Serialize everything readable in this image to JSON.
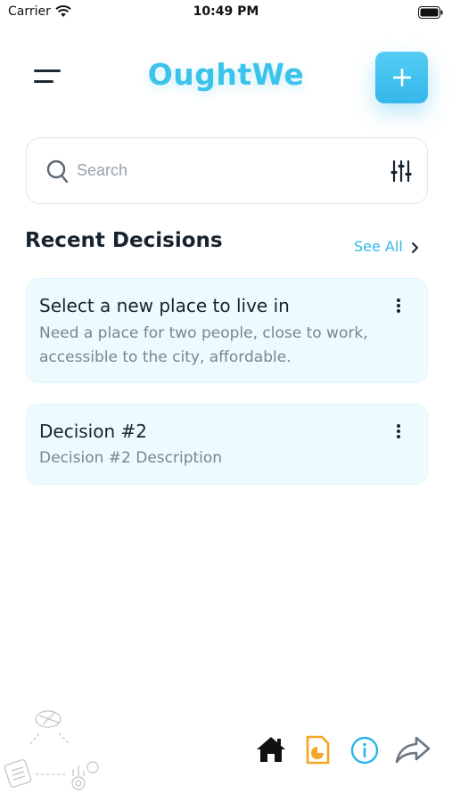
{
  "status_bar": {
    "carrier": "Carrier",
    "time": "10:49 PM",
    "icons": [
      "wifi-icon",
      "battery-icon"
    ]
  },
  "header": {
    "title": "OughtWe",
    "menu_icon": "menu-icon",
    "add_icon": "plus-icon"
  },
  "search": {
    "placeholder": "Search",
    "value": "",
    "search_icon": "search-icon",
    "filter_icon": "sliders-icon"
  },
  "recent": {
    "heading": "Recent Decisions",
    "see_all_label": "See All",
    "decisions": [
      {
        "title": "Select a new place to live in",
        "description": "Need a place for two people, close to work, accessible to the city, affordable."
      },
      {
        "title": "Decision #2",
        "description": "Decision #2 Description"
      }
    ]
  },
  "bottom_nav": {
    "items": [
      "home-icon",
      "report-icon",
      "info-icon",
      "share-icon"
    ]
  },
  "colors": {
    "accent": "#3cc3ec",
    "button": "#34b7ea",
    "card_bg": "#eefbfe",
    "text_dark": "#17242f",
    "text_muted": "#7b858c",
    "report_orange": "#f5a623",
    "info_blue": "#2bb5e8",
    "share_gray": "#6b7680"
  }
}
